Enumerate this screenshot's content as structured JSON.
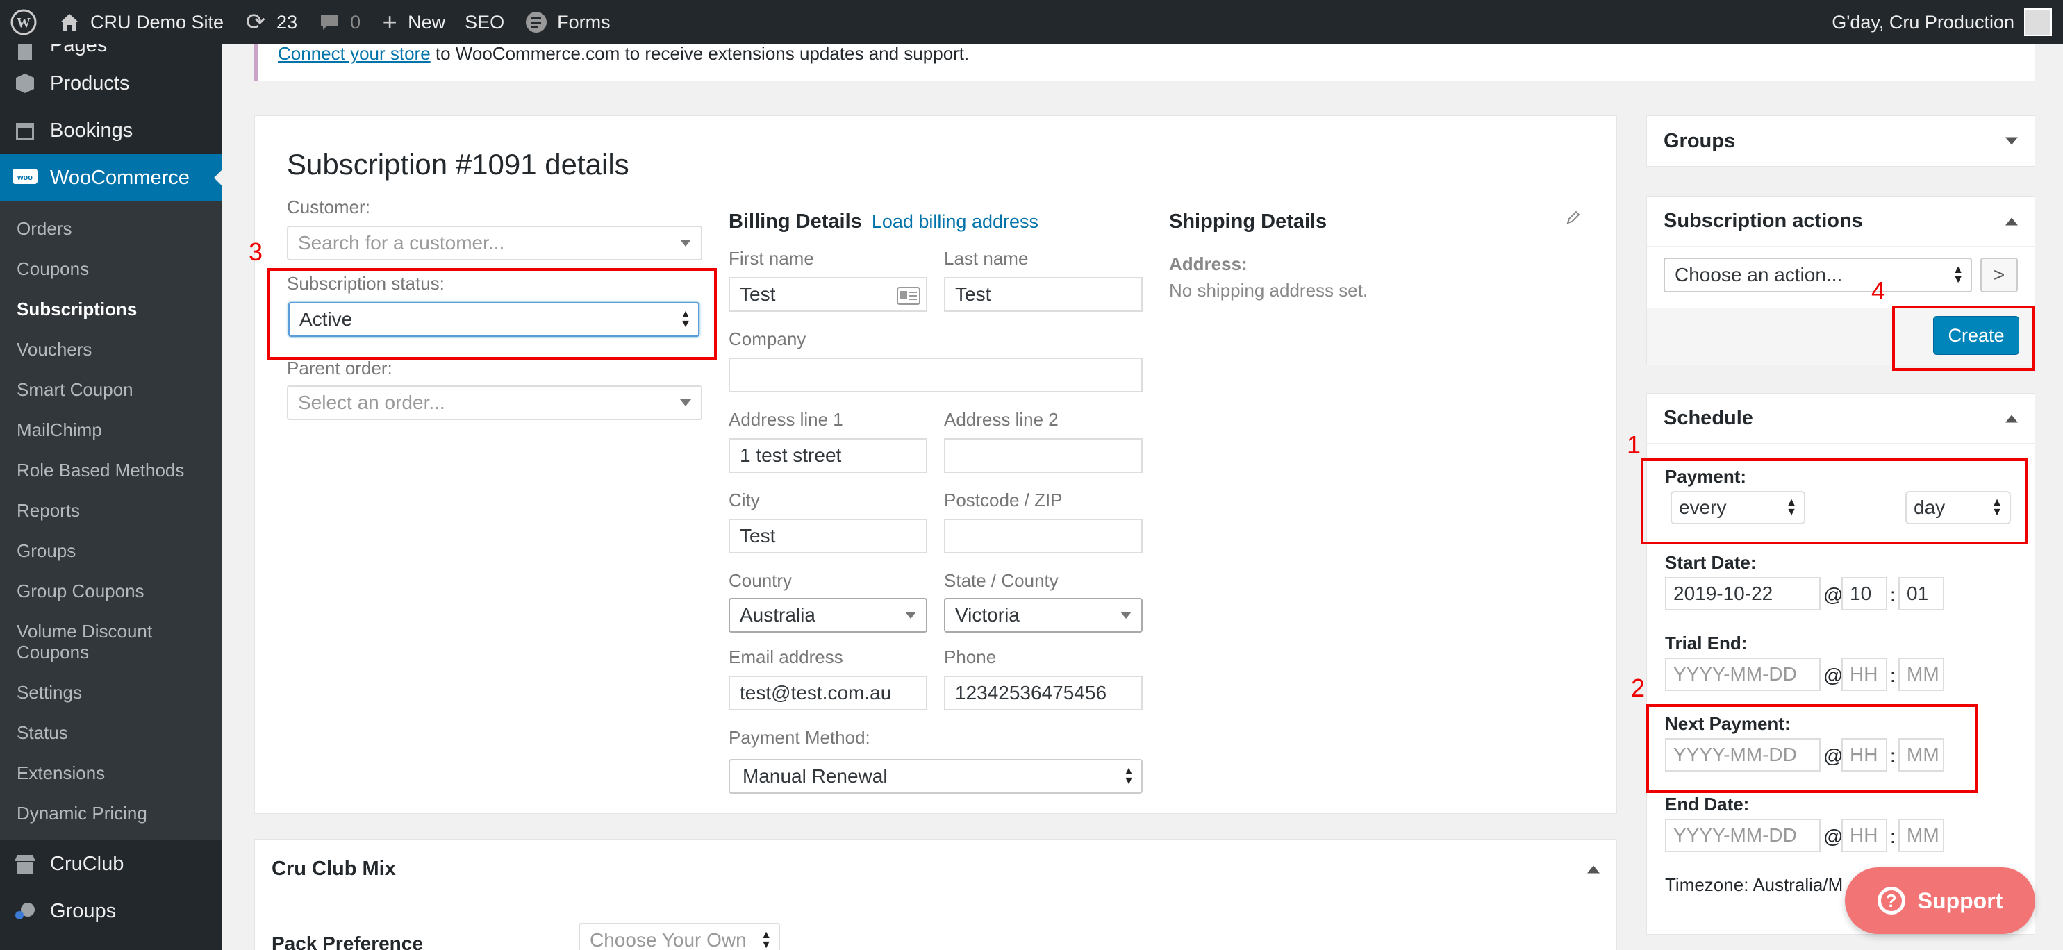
{
  "adminbar": {
    "site_name": "CRU Demo Site",
    "updates_count": "23",
    "comments_count": "0",
    "new_label": "New",
    "seo_label": "SEO",
    "forms_label": "Forms",
    "greeting": "G'day, Cru Production"
  },
  "sidebar": {
    "pages": "Pages",
    "products": "Products",
    "bookings": "Bookings",
    "woocommerce": "WooCommerce",
    "sub_items": [
      "Orders",
      "Coupons",
      "Subscriptions",
      "Vouchers",
      "Smart Coupon",
      "MailChimp",
      "Role Based Methods",
      "Reports",
      "Groups",
      "Group Coupons",
      "Volume Discount Coupons",
      "Settings",
      "Status",
      "Extensions",
      "Dynamic Pricing"
    ],
    "cruclub": "CruClub",
    "groups": "Groups"
  },
  "notice": {
    "link": "Connect your store",
    "text": " to WooCommerce.com to receive extensions updates and support."
  },
  "subscription": {
    "title": "Subscription #1091 details",
    "customer_label": "Customer:",
    "customer_placeholder": "Search for a customer...",
    "status_label": "Subscription status:",
    "status_value": "Active",
    "parent_label": "Parent order:",
    "parent_placeholder": "Select an order..."
  },
  "billing": {
    "title": "Billing Details",
    "load_link": "Load billing address",
    "first_name_label": "First name",
    "first_name": "Test",
    "last_name_label": "Last name",
    "last_name": "Test",
    "company_label": "Company",
    "company": "",
    "address1_label": "Address line 1",
    "address1": "1 test street",
    "address2_label": "Address line 2",
    "address2": "",
    "city_label": "City",
    "city": "Test",
    "postcode_label": "Postcode / ZIP",
    "postcode": "",
    "country_label": "Country",
    "country": "Australia",
    "state_label": "State / County",
    "state": "Victoria",
    "email_label": "Email address",
    "email": "test@test.com.au",
    "phone_label": "Phone",
    "phone": "12342536475456",
    "payment_label": "Payment Method:",
    "payment": "Manual Renewal"
  },
  "shipping": {
    "title": "Shipping Details",
    "address_label": "Address:",
    "address_value": "No shipping address set."
  },
  "cruclub_box": {
    "title": "Cru Club Mix",
    "pack_label": "Pack Preference",
    "pack_value": "Choose Your Own"
  },
  "groups_box": {
    "title": "Groups"
  },
  "actions_box": {
    "title": "Subscription actions",
    "select_placeholder": "Choose an action...",
    "go": ">",
    "create": "Create"
  },
  "schedule": {
    "title": "Schedule",
    "payment_label": "Payment:",
    "interval": "every",
    "period": "day",
    "start_label": "Start Date:",
    "start_date": "2019-10-22",
    "start_hh": "10",
    "start_mm": "01",
    "trial_label": "Trial End:",
    "next_label": "Next Payment:",
    "end_label": "End Date:",
    "date_ph": "YYYY-MM-DD",
    "hh_ph": "HH",
    "mm_ph": "MM",
    "timezone": "Timezone: Australia/M"
  },
  "annotations": {
    "n1": "1",
    "n2": "2",
    "n3": "3",
    "n4": "4"
  },
  "support": {
    "label": "Support"
  },
  "colors": {
    "accent": "#0073aa",
    "admin_dark": "#23282d",
    "annotation": "#ee0000",
    "support": "#f37474"
  }
}
